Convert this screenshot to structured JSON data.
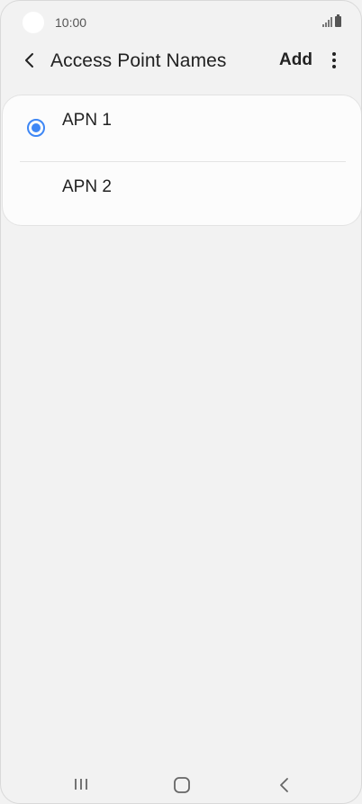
{
  "status_bar": {
    "time": "10:00"
  },
  "header": {
    "title": "Access Point Names",
    "add_label": "Add",
    "back_icon": "chevron-left-icon",
    "more_icon": "more-vertical-icon"
  },
  "apn_list": {
    "items": [
      {
        "label": "APN 1",
        "selected": true
      },
      {
        "label": "APN 2",
        "selected": false
      }
    ]
  },
  "colors": {
    "accent": "#3e87f5",
    "background": "#f2f2f2",
    "card": "#fcfcfc"
  },
  "nav_bar": {
    "icons": [
      "recent-apps-icon",
      "home-icon",
      "back-icon"
    ]
  }
}
